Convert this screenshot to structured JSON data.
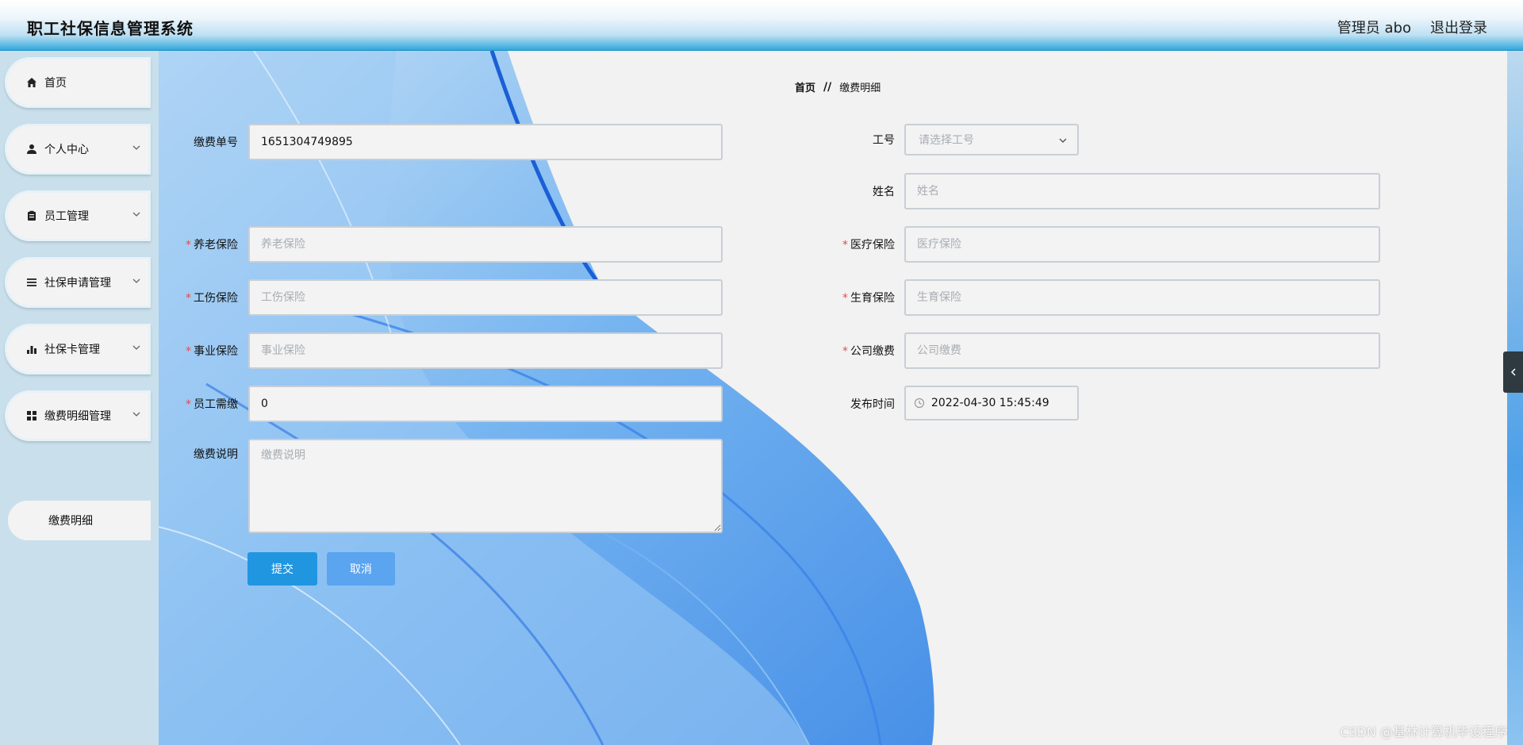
{
  "header": {
    "app_title": "职工社保信息管理系统",
    "user": "管理员 abo",
    "logout": "退出登录"
  },
  "sidebar": {
    "items": [
      {
        "label": "首页",
        "icon": "home-icon"
      },
      {
        "label": "个人中心",
        "icon": "user-icon"
      },
      {
        "label": "员工管理",
        "icon": "clipboard-icon"
      },
      {
        "label": "社保申请管理",
        "icon": "list-icon"
      },
      {
        "label": "社保卡管理",
        "icon": "bar-chart-icon"
      },
      {
        "label": "缴费明细管理",
        "icon": "grid-icon"
      }
    ],
    "sub_item": "缴费明细"
  },
  "breadcrumb": {
    "home": "首页",
    "separator": "//",
    "current": "缴费明细"
  },
  "form": {
    "bill_no": {
      "label": "缴费单号",
      "value": "1651304749895"
    },
    "emp_no": {
      "label": "工号",
      "placeholder": "请选择工号"
    },
    "name": {
      "label": "姓名",
      "placeholder": "姓名"
    },
    "pension": {
      "label": "养老保险",
      "placeholder": "养老保险"
    },
    "medical": {
      "label": "医疗保险",
      "placeholder": "医疗保险"
    },
    "injury": {
      "label": "工伤保险",
      "placeholder": "工伤保险"
    },
    "maternity": {
      "label": "生育保险",
      "placeholder": "生育保险"
    },
    "unemployment": {
      "label": "事业保险",
      "placeholder": "事业保险"
    },
    "company": {
      "label": "公司缴费",
      "placeholder": "公司缴费"
    },
    "employee": {
      "label": "员工需缴",
      "value": "0"
    },
    "publish_time": {
      "label": "发布时间",
      "value": "2022-04-30 15:45:49"
    },
    "remark": {
      "label": "缴费说明",
      "placeholder": "缴费说明"
    },
    "required_mark": "*"
  },
  "buttons": {
    "submit": "提交",
    "cancel": "取消"
  },
  "watermark": "CSDN @基林计算机毕设程序",
  "colors": {
    "primary": "#2196e0",
    "required": "#e54b4b",
    "sidebar_bg": "#c9e0ec"
  }
}
